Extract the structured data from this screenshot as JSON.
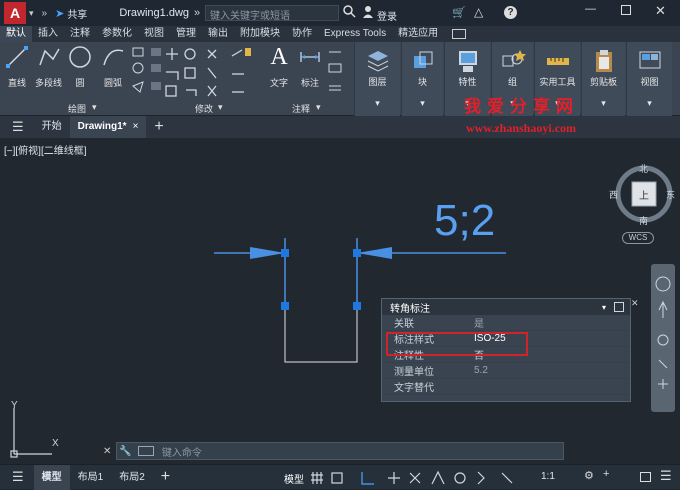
{
  "titlebar": {
    "app_letter": "A",
    "share_label": "共享",
    "doc_title": "Drawing1.dwg",
    "search_placeholder": "键入关键字或短语",
    "login_label": "登录"
  },
  "menu": {
    "tabs": [
      "默认",
      "插入",
      "注释",
      "参数化",
      "视图",
      "管理",
      "输出",
      "附加模块",
      "协作",
      "Express Tools",
      "精选应用"
    ]
  },
  "ribbon": {
    "draw": {
      "line": "直线",
      "polyline": "多段线",
      "circle": "圆",
      "arc": "圆弧",
      "panel": "绘图"
    },
    "modify": {
      "panel": "修改"
    },
    "annotation": {
      "text": "文字",
      "dim": "标注",
      "panel": "注释"
    },
    "layer": "图层",
    "block": "块",
    "properties": "特性",
    "group": "组",
    "utilities": "实用工具",
    "clipboard": "剪贴板",
    "view": "视图"
  },
  "watermark": {
    "line1": "我爱分享网",
    "line2": "www.zhanshaoyi.com"
  },
  "doc_tabs": {
    "start": "开始",
    "active": "Drawing1*"
  },
  "viewport": {
    "label": "[−][俯视][二维线框]"
  },
  "dimension": {
    "text": "5;2"
  },
  "viewcube": {
    "north": "北",
    "south": "南",
    "east": "东",
    "west": "西",
    "face": "上",
    "wcs": "WCS"
  },
  "props_panel": {
    "dropdown": "转角标注",
    "rows": [
      {
        "key": "关联",
        "value": "是"
      },
      {
        "key": "标注样式",
        "value": "ISO-25"
      },
      {
        "key": "注释性",
        "value": "否"
      },
      {
        "key": "测量单位",
        "value": "5.2"
      },
      {
        "key": "文字替代",
        "value": ""
      }
    ]
  },
  "command": {
    "placeholder": "键入命令"
  },
  "ucs": {
    "y": "Y",
    "x": "X"
  },
  "status": {
    "model_tab": "模型",
    "layout1": "布局1",
    "layout2": "布局2",
    "model_btn": "模型",
    "scale": "1:1"
  },
  "colors": {
    "accent": "#3d7fd6",
    "highlight": "#d0242b",
    "dim_text": "#5aa0f0"
  }
}
